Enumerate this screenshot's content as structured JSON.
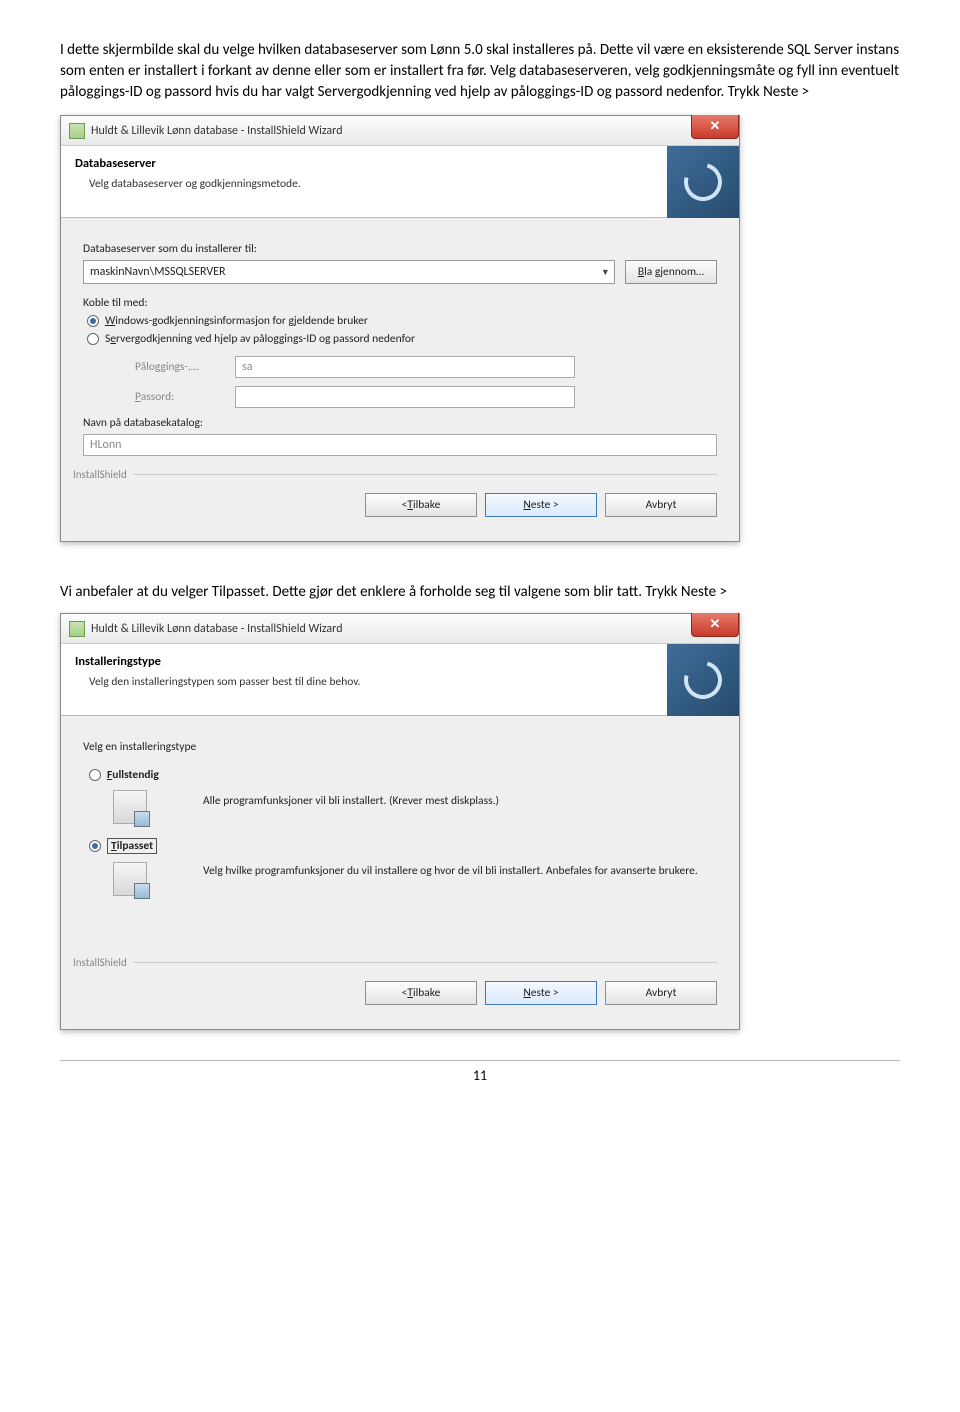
{
  "intro": "I dette skjermbilde skal du velge hvilken databaseserver som Lønn 5.0 skal installeres på. Dette vil være en eksisterende SQL Server instans som enten er installert i forkant av denne eller som er installert fra før. Velg databaseserveren, velg godkjenningsmåte og fyll inn eventuelt påloggings-ID og passord hvis du har valgt Servergodkjenning ved hjelp av påloggings-ID og passord nedenfor. Trykk Neste >",
  "dialog1": {
    "title": "Huldt & Lillevik Lønn database - InstallShield Wizard",
    "headerTitle": "Databaseserver",
    "headerSub": "Velg databaseserver og godkjenningsmetode.",
    "installToLabel": "Databaseserver som du installerer til:",
    "serverValue": "maskinNavn\\MSSQLSERVER",
    "browse": "Bla gjennom…",
    "connectLabel": "Koble til med:",
    "radioWin": "Windows-godkjenningsinformasjon for gjeldende bruker",
    "radioSrv": "Servergodkjenning ved hjelp av påloggings-ID og passord nedenfor",
    "loginLabel": "Påloggings-,…",
    "loginValue": "sa",
    "pwdLabel": "Passord:",
    "catalogLabel": "Navn på databasekatalog:",
    "catalogValue": "HLonn",
    "installShield": "InstallShield",
    "back": "< Tilbake",
    "next": "Neste >",
    "cancel": "Avbryt"
  },
  "mid": "Vi anbefaler at du velger Tilpasset. Dette gjør det enklere å forholde seg til valgene som blir tatt. Trykk Neste >",
  "dialog2": {
    "title": "Huldt & Lillevik Lønn database - InstallShield Wizard",
    "headerTitle": "Installeringstype",
    "headerSub": "Velg den installeringstypen som passer best til dine behov.",
    "chooseLabel": "Velg en installeringstype",
    "fullLabel": "Fullstendig",
    "fullDesc": "Alle programfunksjoner vil bli installert. (Krever mest diskplass.)",
    "customLabel": "Tilpasset",
    "customDesc": "Velg hvilke programfunksjoner du vil installere og hvor de vil bli installert. Anbefales for avanserte brukere.",
    "installShield": "InstallShield",
    "back": "< Tilbake",
    "next": "Neste >",
    "cancel": "Avbryt"
  },
  "pageNumber": "11"
}
